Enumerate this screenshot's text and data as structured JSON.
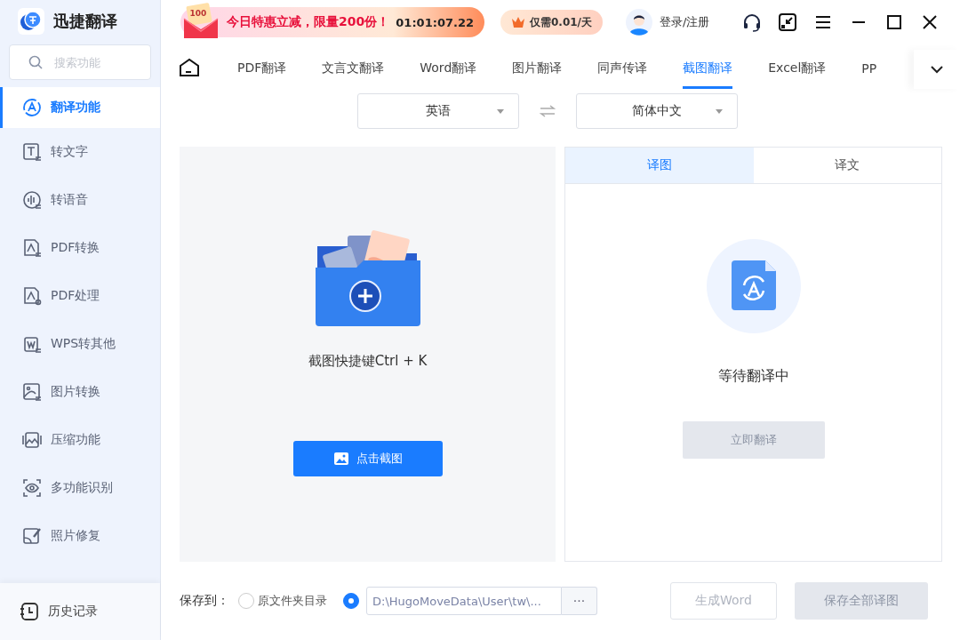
{
  "app": {
    "name": "迅捷翻译"
  },
  "search": {
    "placeholder": "搜索功能"
  },
  "sidebar": {
    "items": [
      {
        "label": "翻译功能",
        "selected": true
      },
      {
        "label": "转文字",
        "selected": false
      },
      {
        "label": "转语音",
        "selected": false
      },
      {
        "label": "PDF转换",
        "selected": false
      },
      {
        "label": "PDF处理",
        "selected": false
      },
      {
        "label": "WPS转其他",
        "selected": false
      },
      {
        "label": "图片转换",
        "selected": false
      },
      {
        "label": "压缩功能",
        "selected": false
      },
      {
        "label": "多功能识别",
        "selected": false
      },
      {
        "label": "照片修复",
        "selected": false
      }
    ],
    "footer": {
      "label": "历史记录"
    }
  },
  "promo": {
    "badge": "100",
    "text": "今日特惠立减，限量200份！",
    "countdown": "01:01:07.22"
  },
  "vip": {
    "label": "仅需0.01/天"
  },
  "user": {
    "label": "登录/注册"
  },
  "tabs": [
    {
      "label": "PDF翻译",
      "selected": false
    },
    {
      "label": "文言文翻译",
      "selected": false
    },
    {
      "label": "Word翻译",
      "selected": false
    },
    {
      "label": "图片翻译",
      "selected": false
    },
    {
      "label": "同声传译",
      "selected": false
    },
    {
      "label": "截图翻译",
      "selected": true
    },
    {
      "label": "Excel翻译",
      "selected": false
    },
    {
      "label": "PP",
      "selected": false
    }
  ],
  "languages": {
    "source": "英语",
    "target": "简体中文"
  },
  "capture": {
    "hint": "截图快捷键Ctrl + K",
    "button": "点击截图"
  },
  "result": {
    "tabs": [
      {
        "label": "译图",
        "selected": true
      },
      {
        "label": "译文",
        "selected": false
      }
    ],
    "status": "等待翻译中",
    "button": {
      "label": "立即翻译",
      "disabled": true
    }
  },
  "save": {
    "label": "保存到：",
    "options": [
      {
        "label": "原文件夹目录",
        "selected": false
      },
      {
        "kind": "path",
        "value": "D:\\HugoMoveData\\User\\tw\\...",
        "selected": true
      }
    ],
    "browse": "···"
  },
  "actions": [
    {
      "label": "生成Word",
      "disabled": true,
      "kind": "outline"
    },
    {
      "label": "保存全部译图",
      "disabled": true,
      "kind": "solid"
    }
  ]
}
